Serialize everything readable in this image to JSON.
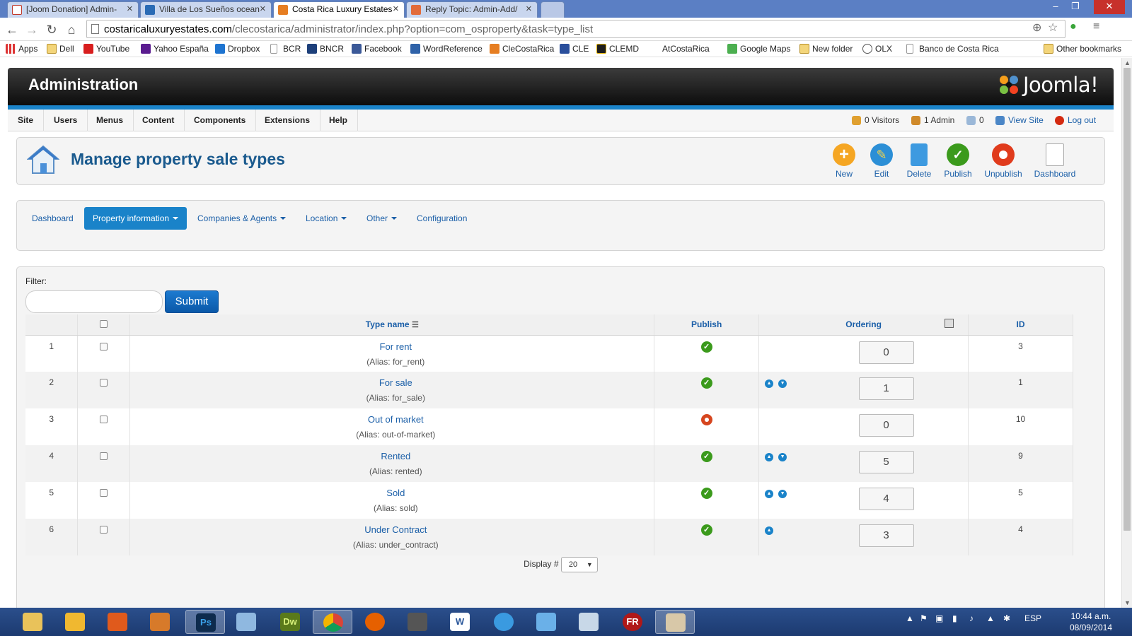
{
  "browser": {
    "tabs": [
      {
        "label": "[Joom Donation] Admin-",
        "favicon_color": "#c0392b"
      },
      {
        "label": "Villa de Los Sueños ocean",
        "favicon_color": "#2a6bb5"
      },
      {
        "label": "Costa Rica Luxury Estates",
        "favicon_color": "#e67e22",
        "active": true
      },
      {
        "label": "Reply Topic: Admin-Add/",
        "favicon_color": "#e26b3a"
      }
    ],
    "url_domain": "costaricaluxuryestates.com",
    "url_path": "/clecostarica/administrator/index.php?option=com_osproperty&task=type_list",
    "bookmarks": [
      "Apps",
      "Dell",
      "YouTube",
      "Yahoo España",
      "Dropbox",
      "BCR",
      "BNCR",
      "Facebook",
      "WordReference",
      "CleCostaRica",
      "CLE",
      "CLEMD",
      "AtCostaRica",
      "Google Maps",
      "New folder",
      "OLX",
      "Banco de Costa Rica",
      "Other bookmarks"
    ]
  },
  "header": {
    "title": "Administration",
    "logo_text": "Joomla!"
  },
  "menu": {
    "items": [
      "Site",
      "Users",
      "Menus",
      "Content",
      "Components",
      "Extensions",
      "Help"
    ],
    "status": {
      "visitors": "0 Visitors",
      "admin": "1 Admin",
      "messages": "0",
      "view_site": "View Site",
      "logout": "Log out"
    }
  },
  "toolbar": {
    "title": "Manage property sale types",
    "buttons": {
      "new": "New",
      "edit": "Edit",
      "delete": "Delete",
      "publish": "Publish",
      "unpublish": "Unpublish",
      "dashboard": "Dashboard"
    }
  },
  "submenu": {
    "dashboard": "Dashboard",
    "property_information": "Property information",
    "companies_agents": "Companies & Agents",
    "location": "Location",
    "other": "Other",
    "configuration": "Configuration"
  },
  "filter": {
    "label": "Filter:",
    "value": "",
    "submit": "Submit"
  },
  "table": {
    "headers": {
      "type_name": "Type name",
      "publish": "Publish",
      "ordering": "Ordering",
      "id": "ID"
    },
    "rows": [
      {
        "num": "1",
        "name": "For rent",
        "alias": "(Alias: for_rent)",
        "published": true,
        "up": false,
        "down": false,
        "ordering": "0",
        "id": "3"
      },
      {
        "num": "2",
        "name": "For sale",
        "alias": "(Alias: for_sale)",
        "published": true,
        "up": true,
        "down": true,
        "ordering": "1",
        "id": "1"
      },
      {
        "num": "3",
        "name": "Out of market",
        "alias": "(Alias: out-of-market)",
        "published": false,
        "up": false,
        "down": false,
        "ordering": "0",
        "id": "10"
      },
      {
        "num": "4",
        "name": "Rented",
        "alias": "(Alias: rented)",
        "published": true,
        "up": true,
        "down": true,
        "ordering": "5",
        "id": "9"
      },
      {
        "num": "5",
        "name": "Sold",
        "alias": "(Alias: sold)",
        "published": true,
        "up": true,
        "down": true,
        "ordering": "4",
        "id": "5"
      },
      {
        "num": "6",
        "name": "Under Contract",
        "alias": "(Alias: under_contract)",
        "published": true,
        "up": true,
        "down": false,
        "ordering": "3",
        "id": "4"
      }
    ]
  },
  "pagination": {
    "display_label": "Display #",
    "display_value": "20"
  },
  "taskbar": {
    "lang": "ESP",
    "time": "10:44 a.m.",
    "date": "08/09/2014"
  }
}
